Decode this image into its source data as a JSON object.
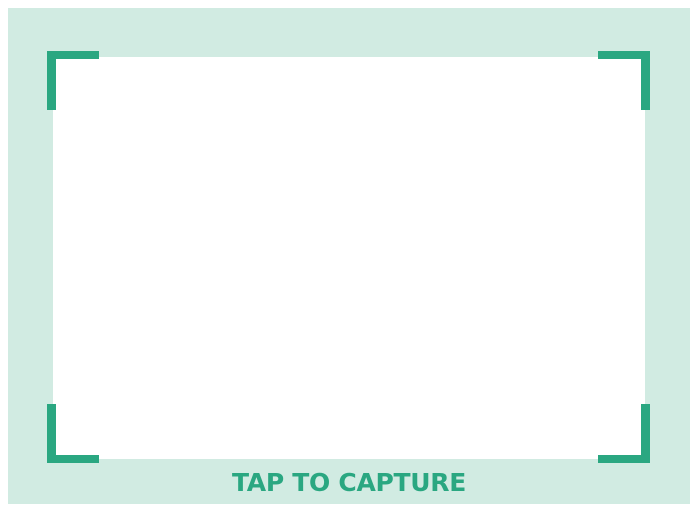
{
  "capture": {
    "label": "TAP TO CAPTURE"
  },
  "colors": {
    "frame_background": "#d1ebe2",
    "accent": "#2aa781",
    "viewfinder_background": "#ffffff"
  }
}
